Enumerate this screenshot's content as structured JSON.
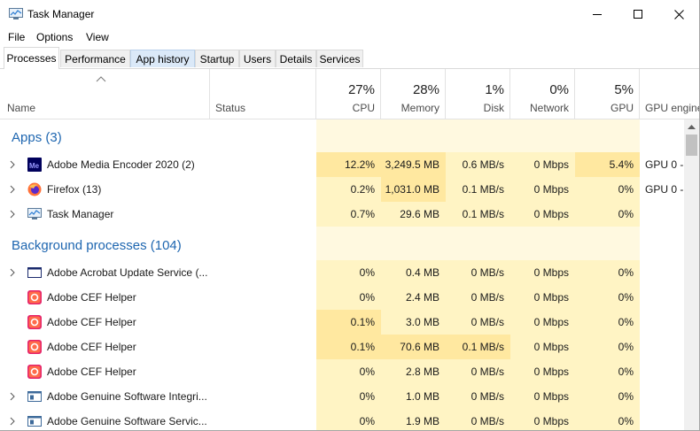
{
  "window": {
    "title": "Task Manager"
  },
  "menu": [
    "File",
    "Options",
    "View"
  ],
  "tabs": [
    "Processes",
    "Performance",
    "App history",
    "Startup",
    "Users",
    "Details",
    "Services"
  ],
  "columns": {
    "name": "Name",
    "status": "Status",
    "cpu": {
      "pct": "27%",
      "label": "CPU"
    },
    "memory": {
      "pct": "28%",
      "label": "Memory"
    },
    "disk": {
      "pct": "1%",
      "label": "Disk"
    },
    "network": {
      "pct": "0%",
      "label": "Network"
    },
    "gpu": {
      "pct": "5%",
      "label": "GPU"
    },
    "gpu_engine": "GPU engine"
  },
  "groups": {
    "apps": "Apps (3)",
    "background": "Background processes (104)"
  },
  "apps": [
    {
      "name": "Adobe Media Encoder 2020 (2)",
      "cpu": "12.2%",
      "memory": "3,249.5 MB",
      "disk": "0.6 MB/s",
      "network": "0 Mbps",
      "gpu": "5.4%",
      "gpu_engine": "GPU 0 -"
    },
    {
      "name": "Firefox (13)",
      "cpu": "0.2%",
      "memory": "1,031.0 MB",
      "disk": "0.1 MB/s",
      "network": "0 Mbps",
      "gpu": "0%",
      "gpu_engine": "GPU 0 -"
    },
    {
      "name": "Task Manager",
      "cpu": "0.7%",
      "memory": "29.6 MB",
      "disk": "0.1 MB/s",
      "network": "0 Mbps",
      "gpu": "0%",
      "gpu_engine": ""
    }
  ],
  "background": [
    {
      "name": "Adobe Acrobat Update Service (...",
      "cpu": "0%",
      "memory": "0.4 MB",
      "disk": "0 MB/s",
      "network": "0 Mbps",
      "gpu": "0%"
    },
    {
      "name": "Adobe CEF Helper",
      "cpu": "0%",
      "memory": "2.4 MB",
      "disk": "0 MB/s",
      "network": "0 Mbps",
      "gpu": "0%"
    },
    {
      "name": "Adobe CEF Helper",
      "cpu": "0.1%",
      "memory": "3.0 MB",
      "disk": "0 MB/s",
      "network": "0 Mbps",
      "gpu": "0%"
    },
    {
      "name": "Adobe CEF Helper",
      "cpu": "0.1%",
      "memory": "70.6 MB",
      "disk": "0.1 MB/s",
      "network": "0 Mbps",
      "gpu": "0%"
    },
    {
      "name": "Adobe CEF Helper",
      "cpu": "0%",
      "memory": "2.8 MB",
      "disk": "0 MB/s",
      "network": "0 Mbps",
      "gpu": "0%"
    },
    {
      "name": "Adobe Genuine Software Integri...",
      "cpu": "0%",
      "memory": "1.0 MB",
      "disk": "0 MB/s",
      "network": "0 Mbps",
      "gpu": "0%"
    },
    {
      "name": "Adobe Genuine Software Servic...",
      "cpu": "0%",
      "memory": "1.9 MB",
      "disk": "0 MB/s",
      "network": "0 Mbps",
      "gpu": "0%"
    }
  ],
  "colors": {
    "group_text": "#1e66b0",
    "heat_light": "#fff4c4",
    "heat_mid": "#ffe8a0"
  }
}
